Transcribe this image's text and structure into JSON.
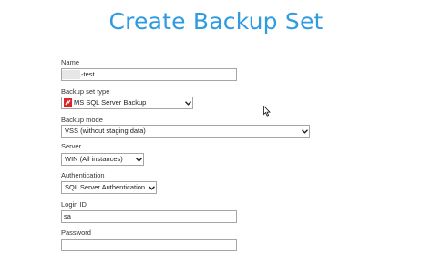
{
  "title": "Create Backup Set",
  "name": {
    "label": "Name",
    "value_suffix": "-test"
  },
  "backup_set_type": {
    "label": "Backup set type",
    "selected": "MS SQL Server Backup",
    "icon": "mssql-icon"
  },
  "backup_mode": {
    "label": "Backup mode",
    "selected": "VSS (without staging data)"
  },
  "server": {
    "label": "Server",
    "selected": "WIN (All instances)"
  },
  "authentication": {
    "label": "Authentication",
    "selected": "SQL Server Authentication"
  },
  "login_id": {
    "label": "Login ID",
    "value": "sa"
  },
  "password": {
    "label": "Password",
    "value": ""
  },
  "colors": {
    "title": "#2f9be0",
    "field_border": "#a6a6a6",
    "icon_red": "#d9262b"
  }
}
